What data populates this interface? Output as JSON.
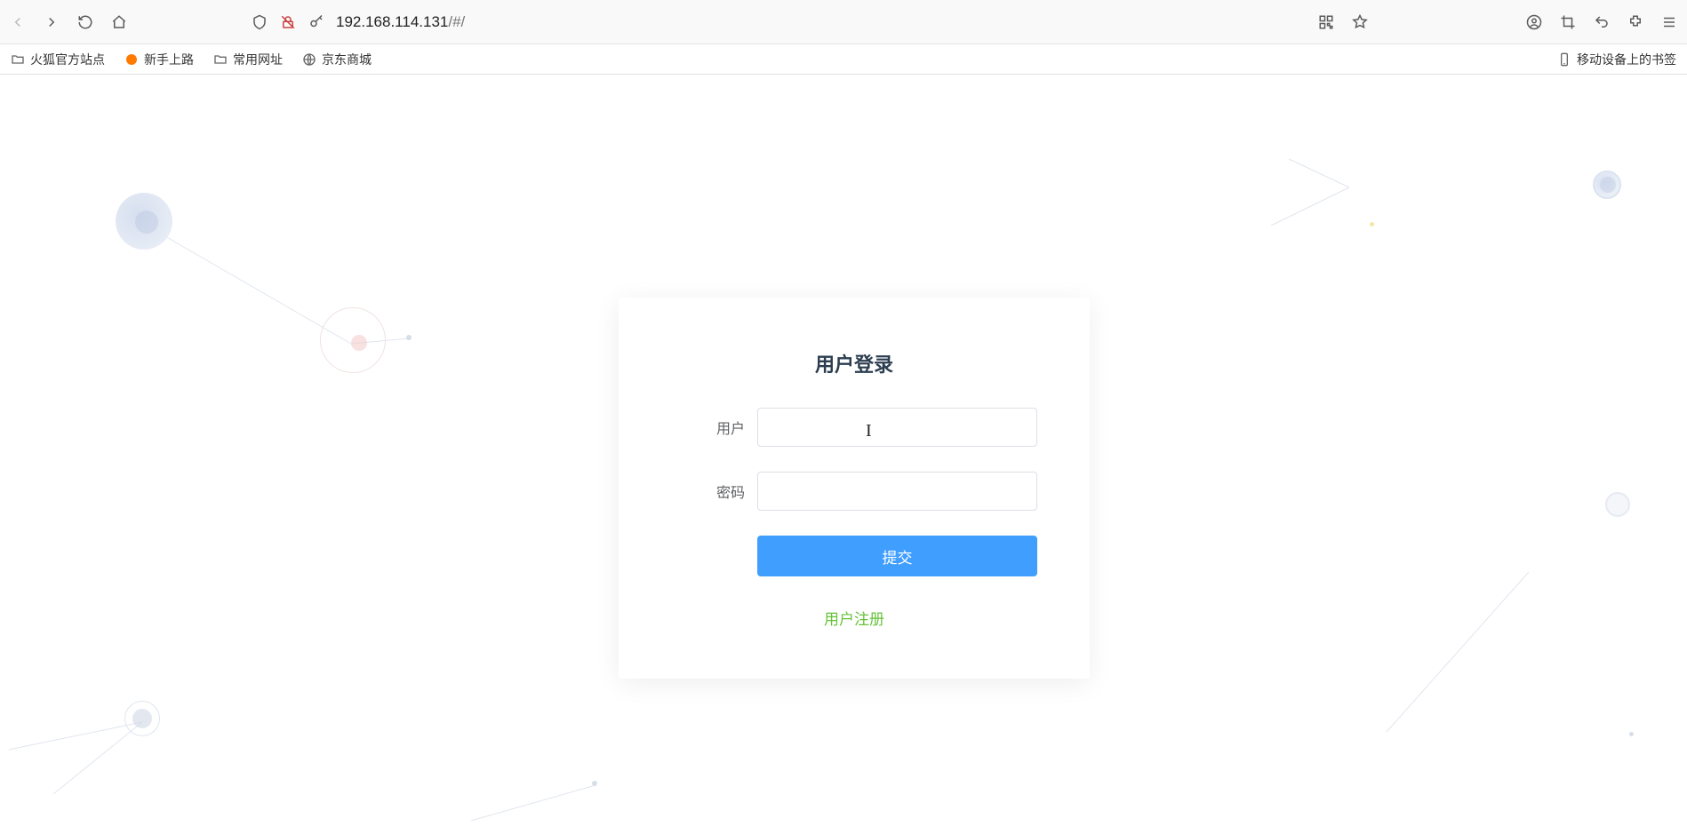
{
  "browser": {
    "url_host": "192.168.114.131",
    "url_path": "/#/"
  },
  "bookmarks": {
    "items": [
      {
        "label": "火狐官方站点",
        "icon": "folder"
      },
      {
        "label": "新手上路",
        "icon": "firefox"
      },
      {
        "label": "常用网址",
        "icon": "folder"
      },
      {
        "label": "京东商城",
        "icon": "globe"
      }
    ],
    "mobile_label": "移动设备上的书签"
  },
  "login": {
    "title": "用户登录",
    "user_label": "用户",
    "password_label": "密码",
    "user_value": "",
    "password_value": "",
    "submit_label": "提交",
    "register_link_label": "用户注册"
  }
}
